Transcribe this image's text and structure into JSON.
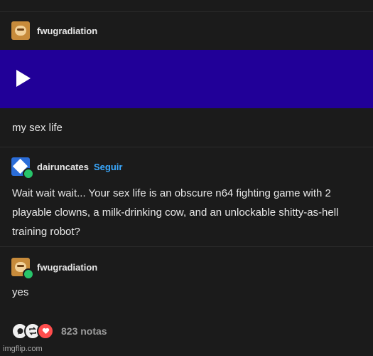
{
  "posts": [
    {
      "username": "fwugradiation",
      "text": "my sex life"
    },
    {
      "username": "dairuncates",
      "follow_label": "Seguir",
      "text": "Wait wait wait... Your sex life is an obscure n64 fighting game with 2 playable clowns, a milk-drinking cow, and an unlockable shitty-as-hell training robot?"
    },
    {
      "username": "fwugradiation",
      "text": "yes"
    }
  ],
  "video": {
    "accent": "#210098"
  },
  "footer": {
    "notes": "823 notas"
  },
  "watermark": "imgflip.com",
  "icons": [
    "play-icon",
    "comment-icon",
    "reblog-icon",
    "heart-icon"
  ]
}
